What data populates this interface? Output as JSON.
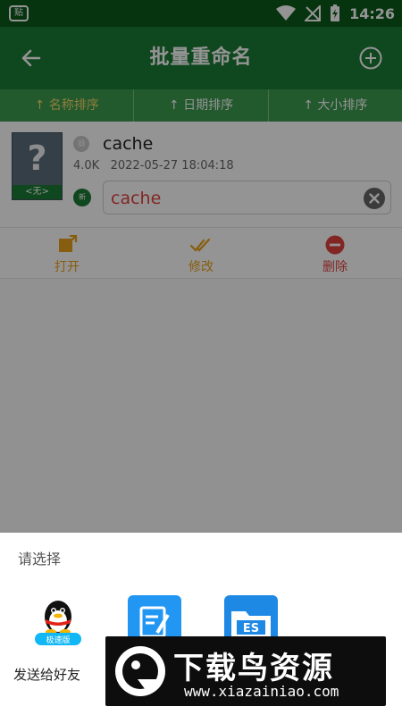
{
  "status_bar": {
    "app_badge": "贴",
    "time": "14:26"
  },
  "app_bar": {
    "title": "批量重命名"
  },
  "sort_tabs": [
    {
      "label": "↑ 名称排序",
      "active": true
    },
    {
      "label": "↑ 日期排序",
      "active": false
    },
    {
      "label": "↑ 大小排序",
      "active": false
    }
  ],
  "file": {
    "thumb_symbol": "?",
    "thumb_caption": "<无>",
    "old_badge": "旧",
    "name": "cache",
    "size": "4.0K",
    "date": "2022-05-27 18:04:18",
    "new_badge": "新",
    "new_name": "cache"
  },
  "actions": {
    "open": "打开",
    "edit": "修改",
    "delete": "删除"
  },
  "colors": {
    "primary": "#1b7a34",
    "sort_active": "#f6d96b",
    "action_orange": "#e8a21a",
    "danger": "#e0433e"
  },
  "chooser": {
    "title": "请选择",
    "targets": [
      {
        "name": "发送给好友",
        "icon": "qq-icon",
        "icon_badge": "极速版"
      },
      {
        "name": "",
        "icon": "notes-icon"
      },
      {
        "name": "",
        "icon": "folder-icon"
      }
    ]
  },
  "watermark": {
    "title": "下载鸟资源",
    "url": "www.xiazainiao.com"
  }
}
